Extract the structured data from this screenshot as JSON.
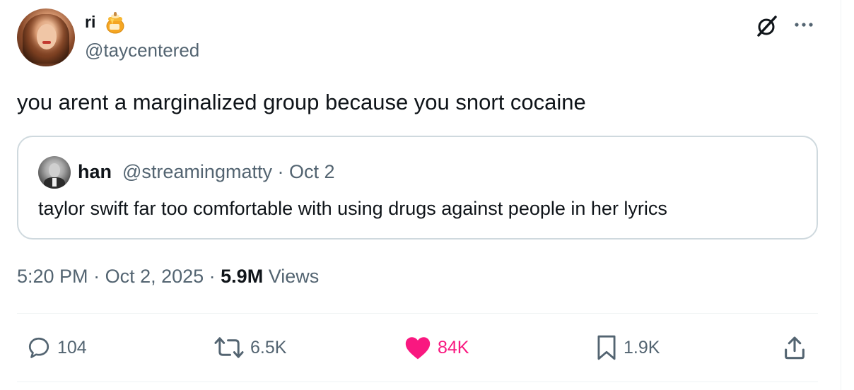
{
  "author": {
    "display_name": "ri",
    "name_emoji": "honey-pot-emoji",
    "handle": "@taycentered"
  },
  "tweet": {
    "text": "you arent a marginalized group because you snort cocaine"
  },
  "quoted_tweet": {
    "display_name": "han",
    "meta": "@streamingmatty · Oct 2",
    "text": "taylor swift far too comfortable with using drugs against people in her lyrics"
  },
  "meta": {
    "time": "5:20 PM",
    "separator1": " · ",
    "date": "Oct 2, 2025",
    "separator2": " · ",
    "views_count": "5.9M",
    "views_label": " Views"
  },
  "actions": {
    "replies": "104",
    "reposts": "6.5K",
    "likes": "84K",
    "bookmarks": "1.9K"
  },
  "colors": {
    "text_primary": "#0f1419",
    "text_secondary": "#536471",
    "like_pink": "#f91880",
    "border": "#cfd9de"
  },
  "icons": [
    "grok-icon",
    "more-icon",
    "reply-icon",
    "repost-icon",
    "heart-icon",
    "bookmark-icon",
    "share-icon"
  ]
}
